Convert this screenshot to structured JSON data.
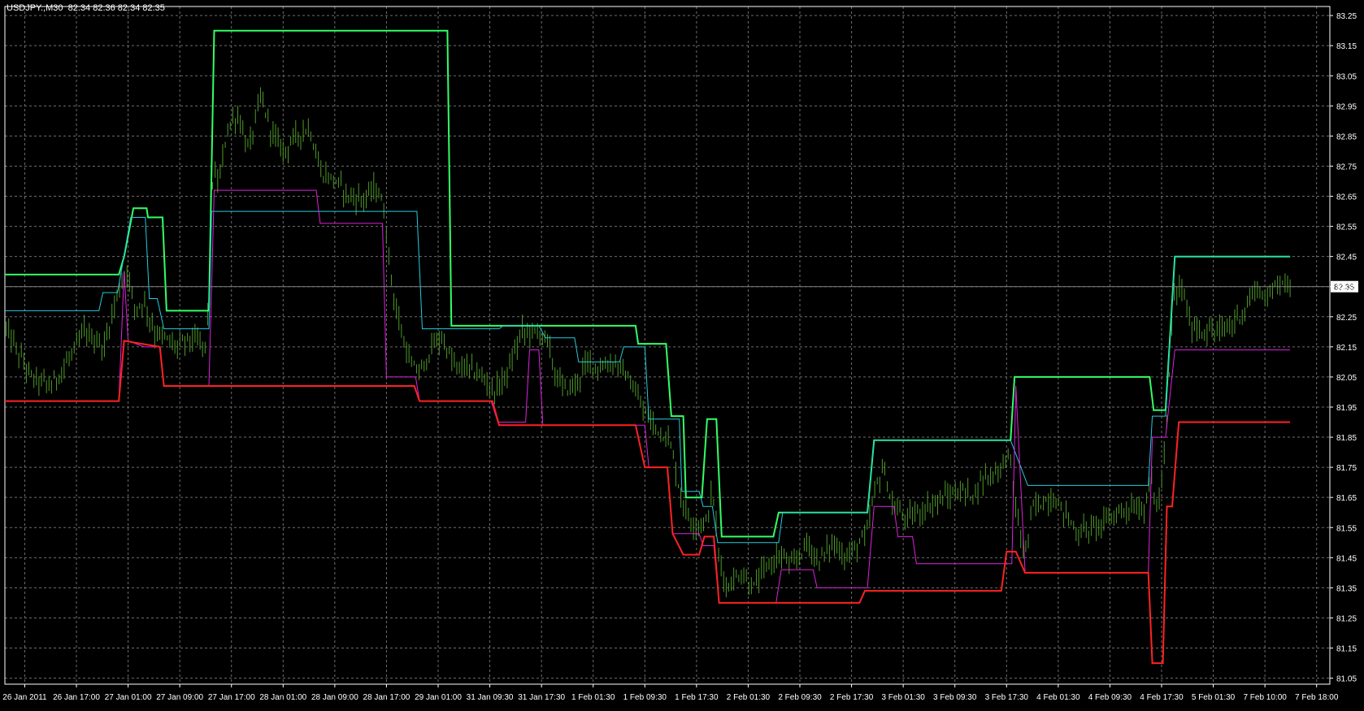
{
  "header": {
    "symbol": "USDJPY.,M30",
    "ohlc": "82.34 82.36 82.34 82.35"
  },
  "colors": {
    "background": "#000000",
    "grid": "#6e6e6e",
    "frame": "#ffffff",
    "price": "#4f9a28",
    "outer_upper": "#33ff66",
    "inner_upper": "#22ccdd",
    "inner_lower": "#dd22dd",
    "outer_lower": "#ff2222",
    "current_price_line": "#808080"
  },
  "chart_data": {
    "type": "line",
    "title": "USDJPY.,M30",
    "xlabel": "",
    "ylabel": "",
    "ylim": [
      81.03,
      83.28
    ],
    "xlim": [
      0,
      100
    ],
    "grid": true,
    "yticks": [
      83.25,
      83.15,
      83.05,
      82.95,
      82.85,
      82.75,
      82.65,
      82.55,
      82.45,
      82.35,
      82.25,
      82.15,
      82.05,
      81.95,
      81.85,
      81.75,
      81.65,
      81.55,
      81.45,
      81.35,
      81.25,
      81.15,
      81.05
    ],
    "current_price": 82.35,
    "xticks": [
      {
        "label": "26 Jan 2011",
        "x": 1.5
      },
      {
        "label": "26 Jan 17:00",
        "x": 5.4
      },
      {
        "label": "27 Jan 01:00",
        "x": 9.3
      },
      {
        "label": "27 Jan 09:00",
        "x": 13.2
      },
      {
        "label": "27 Jan 17:00",
        "x": 17.1
      },
      {
        "label": "28 Jan 01:00",
        "x": 21.0
      },
      {
        "label": "28 Jan 09:00",
        "x": 24.9
      },
      {
        "label": "28 Jan 17:00",
        "x": 28.8
      },
      {
        "label": "29 Jan 01:00",
        "x": 32.7
      },
      {
        "label": "31 Jan 09:30",
        "x": 36.6
      },
      {
        "label": "31 Jan 17:30",
        "x": 40.5
      },
      {
        "label": "1 Feb 01:30",
        "x": 44.4
      },
      {
        "label": "1 Feb 09:30",
        "x": 48.3
      },
      {
        "label": "1 Feb 17:30",
        "x": 52.2
      },
      {
        "label": "2 Feb 01:30",
        "x": 56.1
      },
      {
        "label": "2 Feb 09:30",
        "x": 60.0
      },
      {
        "label": "2 Feb 17:30",
        "x": 63.9
      },
      {
        "label": "3 Feb 01:30",
        "x": 67.8
      },
      {
        "label": "3 Feb 09:30",
        "x": 71.7
      },
      {
        "label": "3 Feb 17:30",
        "x": 75.6
      },
      {
        "label": "4 Feb 01:30",
        "x": 79.5
      },
      {
        "label": "4 Feb 09:30",
        "x": 83.4
      },
      {
        "label": "4 Feb 17:30",
        "x": 87.3
      },
      {
        "label": "5 Feb 01:30",
        "x": 91.2
      },
      {
        "label": "7 Feb 10:00",
        "x": 95.1
      },
      {
        "label": "7 Feb 18:00",
        "x": 99.0
      }
    ],
    "series": [
      {
        "key": "outer_upper",
        "points": [
          [
            0,
            82.39
          ],
          [
            8.6,
            82.39
          ],
          [
            9.0,
            82.45
          ],
          [
            9.7,
            82.61
          ],
          [
            10.7,
            82.61
          ],
          [
            10.8,
            82.58
          ],
          [
            11.9,
            82.58
          ],
          [
            12.2,
            82.27
          ],
          [
            15.4,
            82.27
          ],
          [
            15.8,
            83.2
          ],
          [
            33.4,
            83.2
          ],
          [
            33.7,
            82.22
          ],
          [
            47.6,
            82.22
          ],
          [
            47.8,
            82.16
          ],
          [
            49.9,
            82.16
          ],
          [
            50.3,
            81.92
          ],
          [
            51.2,
            81.92
          ],
          [
            51.4,
            81.65
          ],
          [
            52.6,
            81.65
          ],
          [
            53.0,
            81.91
          ],
          [
            53.7,
            81.91
          ],
          [
            54.1,
            81.52
          ],
          [
            58.0,
            81.52
          ],
          [
            58.4,
            81.6
          ],
          [
            65.1,
            81.6
          ],
          [
            65.6,
            81.84
          ],
          [
            75.9,
            81.84
          ],
          [
            76.2,
            82.05
          ],
          [
            86.4,
            82.05
          ],
          [
            86.7,
            81.94
          ],
          [
            87.6,
            81.94
          ],
          [
            88.3,
            82.45
          ],
          [
            97.0,
            82.45
          ]
        ]
      },
      {
        "key": "inner_upper",
        "points": [
          [
            0,
            82.27
          ],
          [
            7.1,
            82.27
          ],
          [
            7.4,
            82.33
          ],
          [
            8.5,
            82.33
          ],
          [
            9.5,
            82.58
          ],
          [
            10.6,
            82.58
          ],
          [
            10.9,
            82.31
          ],
          [
            11.5,
            82.31
          ],
          [
            12.0,
            82.21
          ],
          [
            15.4,
            82.21
          ],
          [
            15.6,
            82.6
          ],
          [
            31.1,
            82.6
          ],
          [
            31.5,
            82.21
          ],
          [
            37.3,
            82.21
          ],
          [
            37.6,
            82.22
          ],
          [
            40.3,
            82.22
          ],
          [
            40.8,
            82.18
          ],
          [
            43.0,
            82.18
          ],
          [
            43.3,
            82.1
          ],
          [
            46.4,
            82.1
          ],
          [
            46.7,
            82.15
          ],
          [
            48.3,
            82.15
          ],
          [
            48.6,
            81.91
          ],
          [
            50.9,
            81.91
          ],
          [
            51.1,
            81.67
          ],
          [
            52.4,
            81.67
          ],
          [
            52.7,
            81.62
          ],
          [
            53.4,
            81.62
          ],
          [
            53.8,
            81.5
          ],
          [
            56.3,
            81.5
          ],
          [
            58.4,
            81.5
          ],
          [
            58.7,
            81.6
          ],
          [
            65.1,
            81.6
          ],
          [
            65.6,
            81.84
          ],
          [
            75.9,
            81.84
          ],
          [
            77.2,
            81.69
          ],
          [
            86.3,
            81.69
          ],
          [
            86.6,
            81.92
          ],
          [
            87.6,
            81.92
          ],
          [
            88.3,
            82.45
          ],
          [
            97.0,
            82.45
          ]
        ]
      },
      {
        "key": "inner_lower",
        "points": [
          [
            0,
            81.97
          ],
          [
            8.6,
            81.97
          ],
          [
            9.0,
            82.4
          ],
          [
            9.3,
            82.17
          ],
          [
            10.5,
            82.15
          ],
          [
            11.7,
            82.15
          ],
          [
            12.0,
            82.02
          ],
          [
            15.4,
            82.02
          ],
          [
            15.8,
            82.67
          ],
          [
            23.5,
            82.67
          ],
          [
            23.8,
            82.56
          ],
          [
            28.5,
            82.56
          ],
          [
            28.8,
            82.05
          ],
          [
            31.0,
            82.05
          ],
          [
            31.3,
            81.97
          ],
          [
            36.7,
            81.97
          ],
          [
            37.2,
            81.9
          ],
          [
            39.3,
            81.9
          ],
          [
            39.6,
            82.14
          ],
          [
            40.3,
            82.14
          ],
          [
            40.6,
            81.89
          ],
          [
            48.3,
            81.89
          ],
          [
            48.6,
            81.75
          ],
          [
            50.0,
            81.75
          ],
          [
            50.4,
            81.53
          ],
          [
            52.4,
            81.53
          ],
          [
            52.7,
            81.49
          ],
          [
            53.5,
            81.49
          ],
          [
            53.9,
            81.3
          ],
          [
            58.2,
            81.3
          ],
          [
            58.6,
            81.41
          ],
          [
            61.0,
            81.41
          ],
          [
            61.3,
            81.35
          ],
          [
            65.1,
            81.35
          ],
          [
            65.6,
            81.62
          ],
          [
            67.1,
            81.62
          ],
          [
            67.4,
            81.52
          ],
          [
            68.5,
            81.52
          ],
          [
            68.8,
            81.43
          ],
          [
            76.0,
            81.43
          ],
          [
            76.3,
            82.02
          ],
          [
            77.0,
            81.4
          ],
          [
            86.3,
            81.4
          ],
          [
            86.6,
            81.85
          ],
          [
            87.6,
            81.85
          ],
          [
            88.3,
            82.14
          ],
          [
            90.1,
            82.14
          ],
          [
            90.4,
            82.14
          ],
          [
            97.0,
            82.14
          ]
        ]
      },
      {
        "key": "outer_lower",
        "points": [
          [
            0,
            81.97
          ],
          [
            8.6,
            81.97
          ],
          [
            9.0,
            82.17
          ],
          [
            11.7,
            82.15
          ],
          [
            12.0,
            82.02
          ],
          [
            30.9,
            82.02
          ],
          [
            31.3,
            81.97
          ],
          [
            36.8,
            81.97
          ],
          [
            37.3,
            81.89
          ],
          [
            47.6,
            81.89
          ],
          [
            48.3,
            81.75
          ],
          [
            50.0,
            81.75
          ],
          [
            50.4,
            81.53
          ],
          [
            51.2,
            81.46
          ],
          [
            52.4,
            81.46
          ],
          [
            52.8,
            81.52
          ],
          [
            53.5,
            81.52
          ],
          [
            53.9,
            81.3
          ],
          [
            64.5,
            81.3
          ],
          [
            64.9,
            81.34
          ],
          [
            75.2,
            81.34
          ],
          [
            75.6,
            81.47
          ],
          [
            76.3,
            81.47
          ],
          [
            77.0,
            81.4
          ],
          [
            86.3,
            81.4
          ],
          [
            86.6,
            81.1
          ],
          [
            87.4,
            81.1
          ],
          [
            87.7,
            81.62
          ],
          [
            88.1,
            81.62
          ],
          [
            88.6,
            81.9
          ],
          [
            97.0,
            81.9
          ]
        ]
      }
    ],
    "price_series": {
      "key": "price",
      "anchors": [
        [
          0,
          82.22
        ],
        [
          1,
          82.13
        ],
        [
          2,
          82.05
        ],
        [
          3.5,
          82.02
        ],
        [
          5,
          82.12
        ],
        [
          6,
          82.2
        ],
        [
          7.5,
          82.15
        ],
        [
          8.5,
          82.33
        ],
        [
          9.2,
          82.41
        ],
        [
          9.8,
          82.28
        ],
        [
          10.5,
          82.3
        ],
        [
          11.3,
          82.2
        ],
        [
          12,
          82.18
        ],
        [
          13,
          82.15
        ],
        [
          14,
          82.18
        ],
        [
          15.2,
          82.15
        ],
        [
          15.7,
          82.72
        ],
        [
          16.2,
          82.7
        ],
        [
          16.8,
          82.88
        ],
        [
          17.6,
          82.92
        ],
        [
          18.4,
          82.8
        ],
        [
          19.3,
          82.98
        ],
        [
          20.1,
          82.87
        ],
        [
          21,
          82.8
        ],
        [
          22,
          82.85
        ],
        [
          23,
          82.88
        ],
        [
          23.8,
          82.73
        ],
        [
          25,
          82.7
        ],
        [
          26,
          82.65
        ],
        [
          27,
          82.64
        ],
        [
          28.1,
          82.68
        ],
        [
          28.6,
          82.6
        ],
        [
          29.3,
          82.33
        ],
        [
          29.9,
          82.2
        ],
        [
          30.7,
          82.08
        ],
        [
          31.5,
          82.07
        ],
        [
          32.2,
          82.15
        ],
        [
          33,
          82.18
        ],
        [
          34,
          82.08
        ],
        [
          35,
          82.08
        ],
        [
          36,
          82.05
        ],
        [
          37,
          82.0
        ],
        [
          38,
          82.07
        ],
        [
          39,
          82.2
        ],
        [
          40,
          82.2
        ],
        [
          40.9,
          82.18
        ],
        [
          41.6,
          82.05
        ],
        [
          42.3,
          82.01
        ],
        [
          43,
          82.02
        ],
        [
          44,
          82.1
        ],
        [
          45,
          82.08
        ],
        [
          46,
          82.1
        ],
        [
          47,
          82.05
        ],
        [
          48.3,
          81.93
        ],
        [
          49,
          81.89
        ],
        [
          50,
          81.85
        ],
        [
          50.5,
          81.78
        ],
        [
          51,
          81.65
        ],
        [
          51.8,
          81.57
        ],
        [
          52.4,
          81.56
        ],
        [
          53,
          81.57
        ],
        [
          53.4,
          81.68
        ],
        [
          53.9,
          81.45
        ],
        [
          54.5,
          81.35
        ],
        [
          55.5,
          81.4
        ],
        [
          56.5,
          81.35
        ],
        [
          57.5,
          81.42
        ],
        [
          58.5,
          81.46
        ],
        [
          59.5,
          81.42
        ],
        [
          60.5,
          81.5
        ],
        [
          61.5,
          81.44
        ],
        [
          62.5,
          81.5
        ],
        [
          63.5,
          81.45
        ],
        [
          64.5,
          81.5
        ],
        [
          65,
          81.52
        ],
        [
          65.7,
          81.68
        ],
        [
          66.3,
          81.75
        ],
        [
          67,
          81.62
        ],
        [
          68,
          81.58
        ],
        [
          69,
          81.6
        ],
        [
          70,
          81.63
        ],
        [
          71,
          81.65
        ],
        [
          72,
          81.67
        ],
        [
          73,
          81.66
        ],
        [
          74,
          81.72
        ],
        [
          75,
          81.74
        ],
        [
          75.8,
          81.8
        ],
        [
          76.5,
          81.55
        ],
        [
          77,
          81.46
        ],
        [
          77.6,
          81.62
        ],
        [
          78.2,
          81.63
        ],
        [
          79,
          81.65
        ],
        [
          80,
          81.6
        ],
        [
          81,
          81.53
        ],
        [
          82,
          81.55
        ],
        [
          83,
          81.57
        ],
        [
          84,
          81.6
        ],
        [
          85,
          81.62
        ],
        [
          86,
          81.61
        ],
        [
          86.5,
          81.72
        ],
        [
          87,
          81.6
        ],
        [
          87.6,
          81.82
        ],
        [
          88.2,
          82.32
        ],
        [
          88.8,
          82.35
        ],
        [
          89.5,
          82.22
        ],
        [
          90.5,
          82.2
        ],
        [
          91.5,
          82.2
        ],
        [
          92.5,
          82.22
        ],
        [
          93.5,
          82.27
        ],
        [
          94.5,
          82.35
        ],
        [
          95.3,
          82.3
        ],
        [
          96,
          82.38
        ],
        [
          97,
          82.35
        ]
      ],
      "volatility": 0.035
    }
  }
}
